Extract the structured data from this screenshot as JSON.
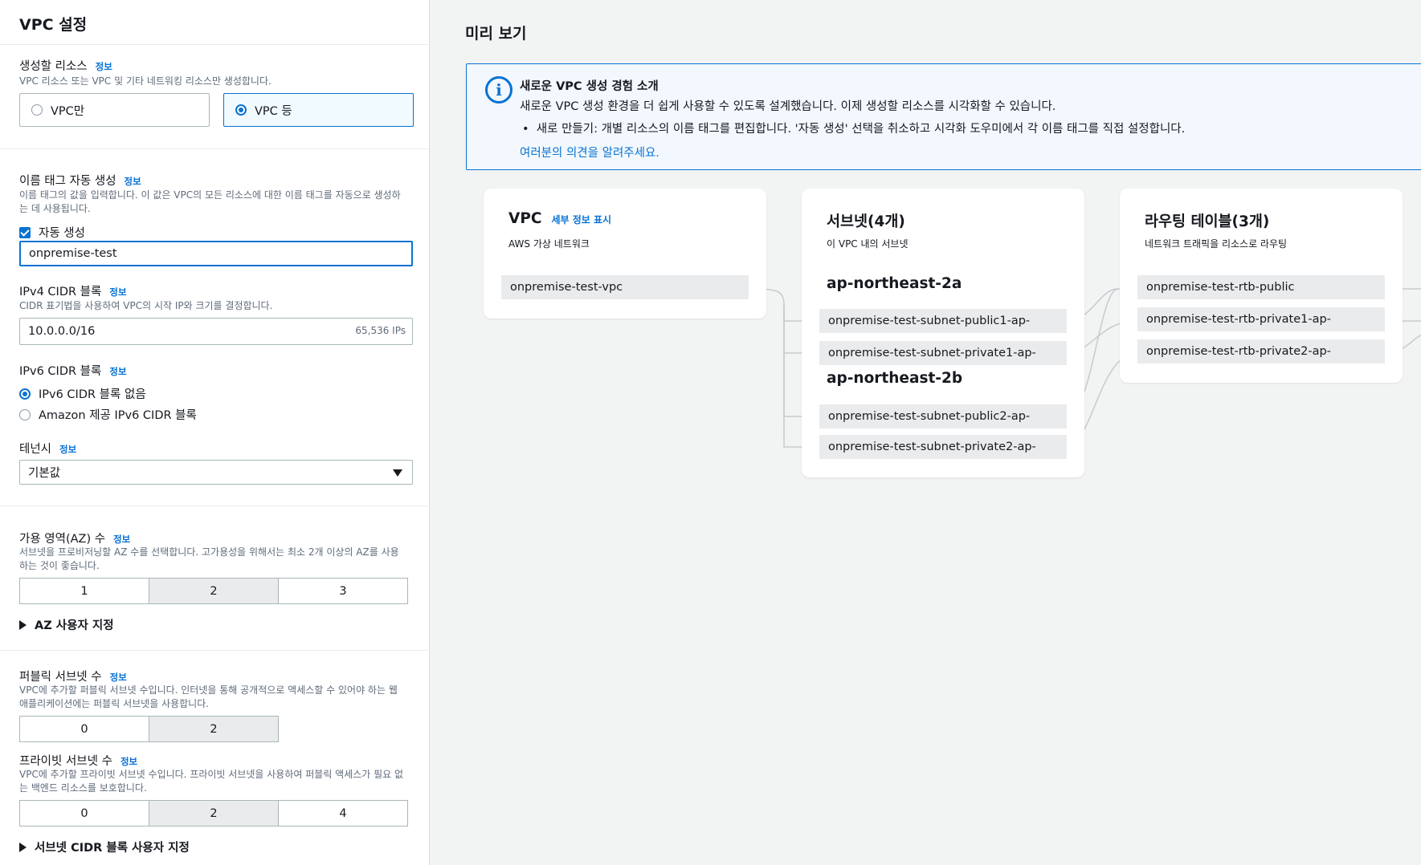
{
  "panel": {
    "title": "VPC 설정"
  },
  "resources": {
    "label": "생성할 리소스",
    "info": "정보",
    "desc": "VPC 리소스 또는 VPC 및 기타 네트워킹 리소스만 생성합니다.",
    "options": [
      "VPC만",
      "VPC 등"
    ],
    "selected": "VPC 등"
  },
  "name_tag": {
    "label": "이름 태그 자동 생성",
    "info": "정보",
    "desc_line1": "이름 태그의 값을 입력합니다. 이 값은 VPC의 모든 리소스에 대한 이름 태그를 자동으로 생성하",
    "desc_line2": "는 데 사용됩니다.",
    "checkbox_label": "자동 생성",
    "checked": true,
    "value": "onpremise-test"
  },
  "ipv4": {
    "label": "IPv4 CIDR 블록",
    "info": "정보",
    "desc": "CIDR 표기법을 사용하여 VPC의 시작 IP와 크기를 결정합니다.",
    "value": "10.0.0.0/16",
    "ips": "65,536 IPs"
  },
  "ipv6": {
    "label": "IPv6 CIDR 블록",
    "info": "정보",
    "options": [
      "IPv6 CIDR 블록 없음",
      "Amazon 제공 IPv6 CIDR 블록"
    ],
    "selected": "IPv6 CIDR 블록 없음"
  },
  "tenancy": {
    "label": "테넌시",
    "info": "정보",
    "value": "기본값"
  },
  "az": {
    "label": "가용 영역(AZ) 수",
    "info": "정보",
    "desc_line1": "서브넷을 프로비저닝할 AZ 수를 선택합니다. 고가용성을 위해서는 최소 2개 이상의 AZ를 사용",
    "desc_line2": "하는 것이 좋습니다.",
    "options": [
      "1",
      "2",
      "3"
    ],
    "selected": "2",
    "customize": "AZ 사용자 지정"
  },
  "public_subnets": {
    "label": "퍼블릭 서브넷 수",
    "info": "정보",
    "desc_line1": "VPC에 추가할 퍼블릭 서브넷 수입니다. 인터넷을 통해 공개적으로 액세스할 수 있어야 하는 웹",
    "desc_line2": "애플리케이션에는 퍼블릭 서브넷을 사용합니다.",
    "options": [
      "0",
      "2"
    ],
    "selected": "2"
  },
  "private_subnets": {
    "label": "프라이빗 서브넷 수",
    "info": "정보",
    "desc_line1": "VPC에 추가할 프라이빗 서브넷 수입니다. 프라이빗 서브넷을 사용하여 퍼블릭 액세스가 필요 없",
    "desc_line2": "는 백엔드 리소스를 보호합니다.",
    "options": [
      "0",
      "2",
      "4"
    ],
    "selected": "2",
    "customize": "서브넷 CIDR 블록 사용자 지정"
  },
  "preview": {
    "title": "미리 보기",
    "alert": {
      "title": "새로운 VPC 생성 경험 소개",
      "body": "새로운 VPC 생성 환경을 더 쉽게 사용할 수 있도록 설계했습니다. 이제 생성할 리소스를 시각화할 수 있습니다.",
      "bullet": "새로 만들기: 개별 리소스의 이름 태그를 편집합니다. '자동 생성' 선택을 취소하고 시각화 도우미에서 각 이름 태그를 직접 설정합니다.",
      "link": "여러분의 의견을 알려주세요."
    },
    "vpc": {
      "title": "VPC",
      "link": "세부 정보 표시",
      "sub": "AWS 가상 네트워크",
      "node": "onpremise-test-vpc"
    },
    "subnets": {
      "title": "서브넷(4개)",
      "sub": "이 VPC 내의 서브넷",
      "az1": "ap-northeast-2a",
      "az1_nodes": [
        "onpremise-test-subnet-public1-ap-",
        "onpremise-test-subnet-private1-ap-"
      ],
      "az2": "ap-northeast-2b",
      "az2_nodes": [
        "onpremise-test-subnet-public2-ap-",
        "onpremise-test-subnet-private2-ap-"
      ]
    },
    "routes": {
      "title": "라우팅 테이블(3개)",
      "sub": "네트워크 트래픽을 리소스로 라우팅",
      "nodes": [
        "onpremise-test-rtb-public",
        "onpremise-test-rtb-private1-ap-",
        "onpremise-test-rtb-private2-ap-"
      ]
    }
  }
}
